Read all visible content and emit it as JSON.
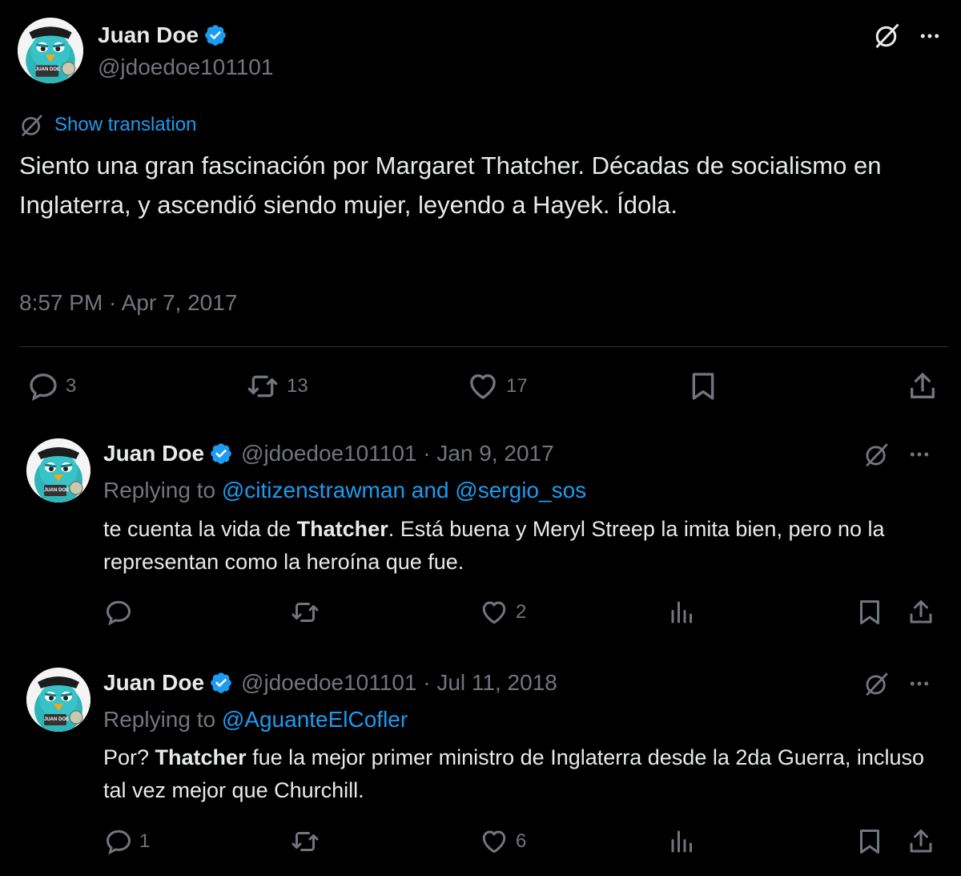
{
  "main": {
    "author_name": "Juan Doe",
    "author_handle": "@jdoedoe101101",
    "show_translation": "Show translation",
    "text": "Siento una gran fascinación por Margaret Thatcher. Décadas de socialismo en Inglaterra, y ascendió siendo mujer, leyendo a Hayek. Ídola.",
    "timestamp": "8:57 PM · Apr 7, 2017",
    "reply_count": "3",
    "retweet_count": "13",
    "like_count": "17"
  },
  "replies": [
    {
      "author_name": "Juan Doe",
      "handle_date": "@jdoedoe101101 · Jan 9, 2017",
      "replying_label": "Replying to",
      "replying_to": "@citizenstrawman and @sergio_sos",
      "text_before": "te cuenta la vida de ",
      "text_bold": "Thatcher",
      "text_after": ". Está buena y Meryl Streep la imita bien, pero no la representan como la heroína que fue.",
      "reply_count": "",
      "like_count": "2"
    },
    {
      "author_name": "Juan Doe",
      "handle_date": "@jdoedoe101101 · Jul 11, 2018",
      "replying_label": "Replying to",
      "replying_to": "@AguanteElCofler",
      "text_before": "Por? ",
      "text_bold": "Thatcher",
      "text_after": " fue la mejor primer ministro de Inglaterra desde la 2da Guerra, incluso tal vez mejor que Churchill.",
      "reply_count": "1",
      "like_count": "6"
    }
  ],
  "avatar_badge": "JUAN DOE",
  "colors": {
    "background": "#000000",
    "text": "#e7e9ea",
    "secondary": "#71767b",
    "accent": "#1d9bf0",
    "divider": "#2f3336"
  },
  "icons": [
    "verified-badge-icon",
    "translate-icon",
    "more-icon",
    "reply-icon",
    "retweet-icon",
    "like-icon",
    "bookmark-icon",
    "share-icon",
    "views-icon"
  ]
}
